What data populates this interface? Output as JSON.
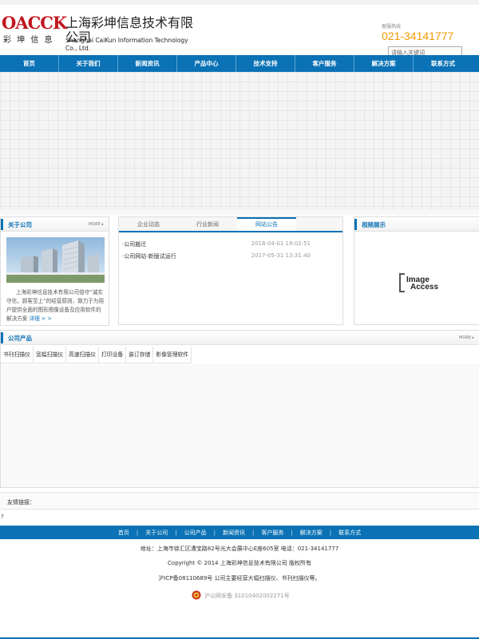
{
  "header": {
    "logo_mark": "OACCK",
    "logo_cn": "上海彩坤信息技术有限公司",
    "logo_sub": "彩 坤 信 息",
    "logo_en": "Shanghai CaiKun Information Technology Co., Ltd.",
    "hotline_label": "客服热线",
    "hotline": "021-34141777",
    "search_placeholder": "请输入关键词"
  },
  "nav": {
    "items": [
      "首页",
      "关于我们",
      "新闻资讯",
      "产品中心",
      "技术支持",
      "客户服务",
      "解决方案",
      "联系方式"
    ]
  },
  "about": {
    "title": "关于公司",
    "more": "MORE ▸",
    "text": "上海彩坤信息技术有限公司倍守“诚实守信，顾客至上”的经营原则，致力于为用户提供全面的图形图像设备及应用软件的解决方案",
    "detail_link": "详细 > >"
  },
  "news": {
    "tabs": [
      "企业动态",
      "行业新闻",
      "网站公告"
    ],
    "active_tab": 2,
    "items": [
      {
        "title": "·公司搬迁",
        "date": "2018-04-01 19:02:51"
      },
      {
        "title": "·公司网站-新版试运行",
        "date": "2017-05-31 13:31:40"
      }
    ]
  },
  "video": {
    "title": "视频展示",
    "logo_line1": "Image",
    "logo_line2": "Access"
  },
  "products": {
    "title": "公司产品",
    "more": "MORE ▸",
    "tabs": [
      "书刊扫描仪",
      "宽幅扫描仪",
      "高速扫描仪",
      "打印设备",
      "装订存储",
      "影像管理软件"
    ]
  },
  "friend_links": {
    "label": "友情链接："
  },
  "stray_char": "?",
  "footer": {
    "nav": [
      "首页",
      "关于公司",
      "公司产品",
      "新闻资讯",
      "客户服务",
      "解决方案",
      "联系方式"
    ],
    "address": "地址：上海市徐汇区漕宝路82号光大会展中心E座605室  电话：021-34141777",
    "copyright": "Copyright © 2014 上海彩坤信息技术有限公司 版权所有",
    "icp": "沪ICP备08110689号    公司主要经营大幅扫描仪、书刊扫描仪等。",
    "police": "沪公网安备 31010402002271号"
  },
  "colors": {
    "brand_blue": "#0a72b5",
    "logo_red": "#c0161f",
    "hotline_orange": "#f39800"
  }
}
